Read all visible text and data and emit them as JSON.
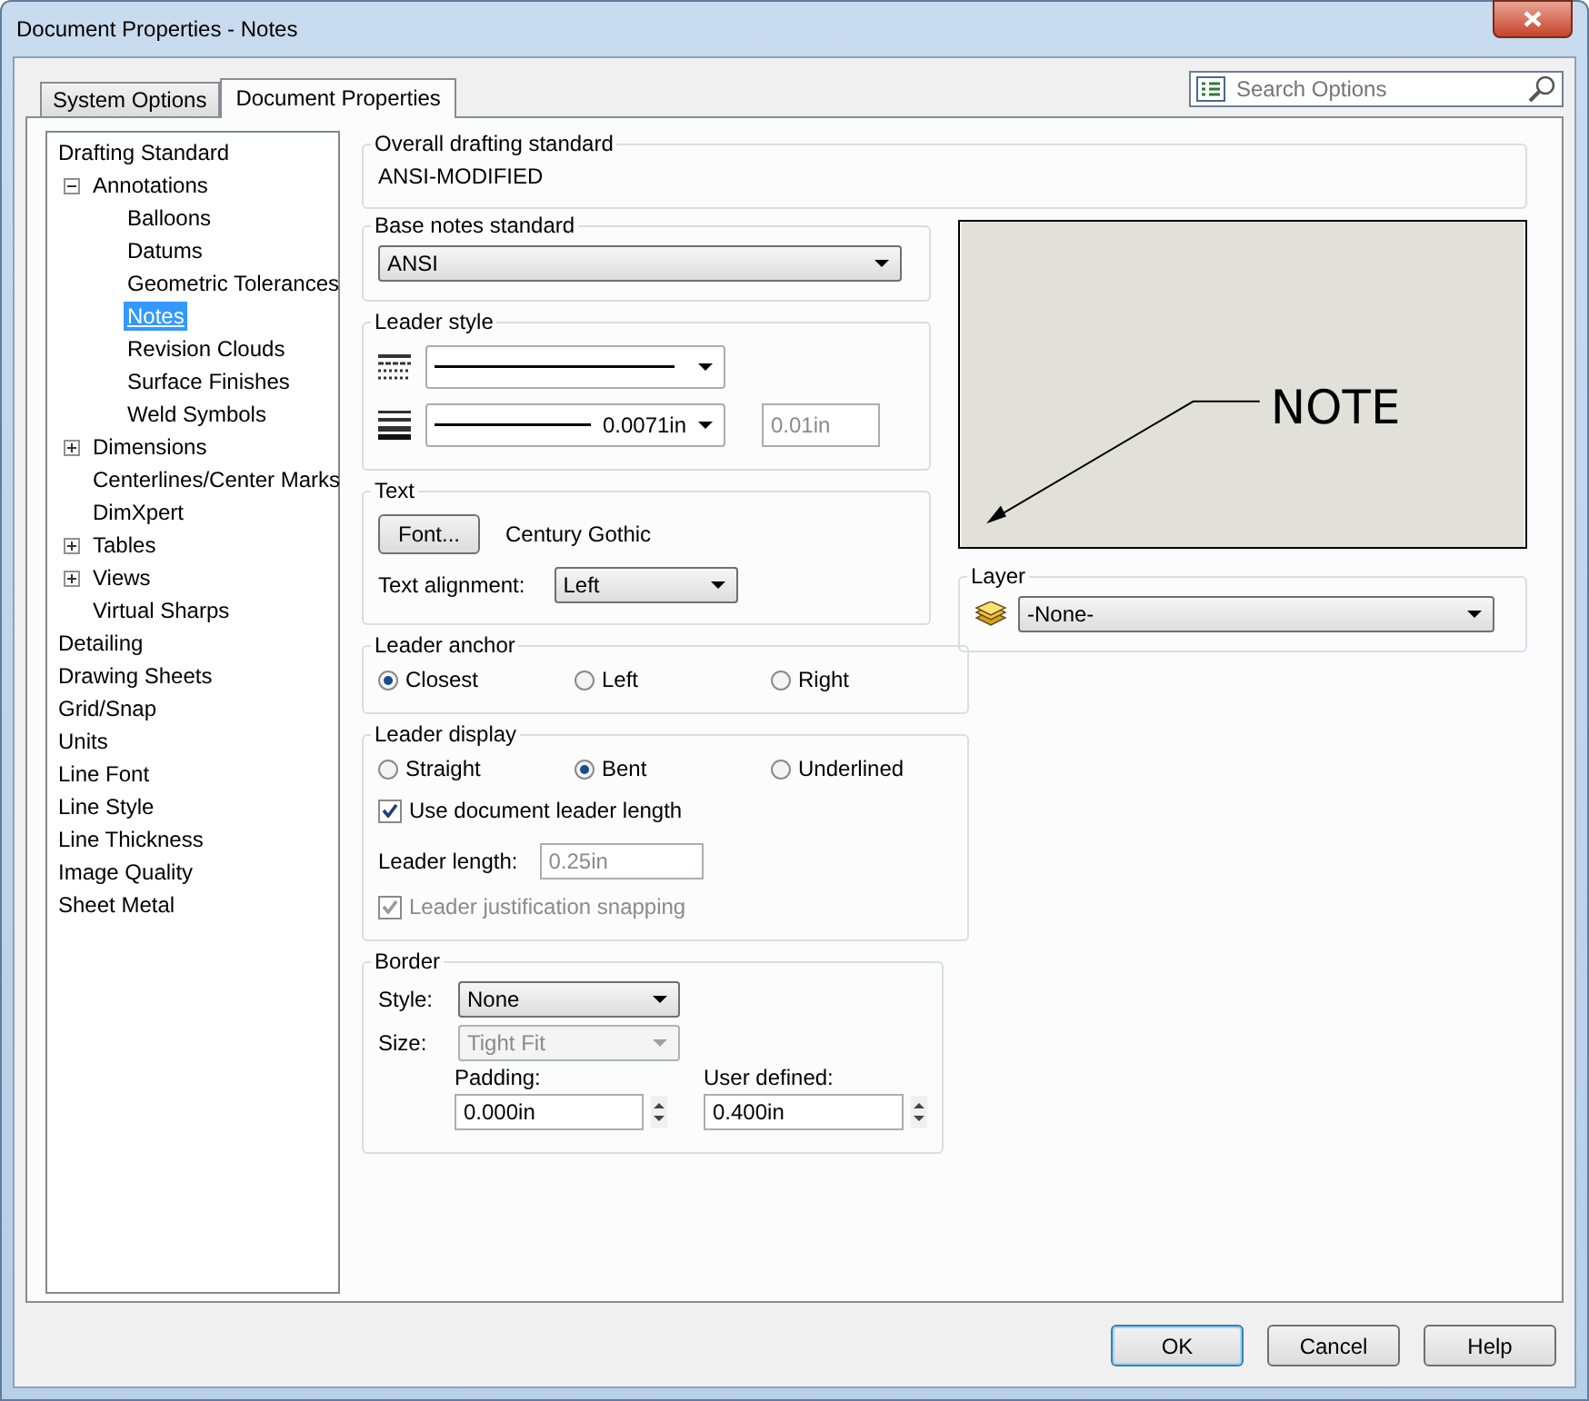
{
  "window": {
    "title": "Document Properties - Notes"
  },
  "tabs": [
    {
      "label": "System Options",
      "selected": false
    },
    {
      "label": "Document Properties",
      "selected": true
    }
  ],
  "search": {
    "placeholder": "Search Options"
  },
  "tree": [
    {
      "label": "Drafting Standard",
      "selected": false,
      "children": [
        {
          "label": "Annotations",
          "selected": false,
          "expanded": true,
          "children": [
            {
              "label": "Balloons",
              "selected": false
            },
            {
              "label": "Datums",
              "selected": false
            },
            {
              "label": "Geometric Tolerances",
              "selected": false
            },
            {
              "label": "Notes",
              "selected": true
            },
            {
              "label": "Revision Clouds",
              "selected": false
            },
            {
              "label": "Surface Finishes",
              "selected": false
            },
            {
              "label": "Weld Symbols",
              "selected": false
            }
          ]
        },
        {
          "label": "Dimensions",
          "selected": false,
          "expanded": false
        },
        {
          "label": "Centerlines/Center Marks",
          "selected": false
        },
        {
          "label": "DimXpert",
          "selected": false
        },
        {
          "label": "Tables",
          "selected": false,
          "expanded": false
        },
        {
          "label": "Views",
          "selected": false,
          "expanded": false
        },
        {
          "label": "Virtual Sharps",
          "selected": false
        }
      ]
    },
    {
      "label": "Detailing",
      "selected": false
    },
    {
      "label": "Drawing Sheets",
      "selected": false
    },
    {
      "label": "Grid/Snap",
      "selected": false
    },
    {
      "label": "Units",
      "selected": false
    },
    {
      "label": "Line Font",
      "selected": false
    },
    {
      "label": "Line Style",
      "selected": false
    },
    {
      "label": "Line Thickness",
      "selected": false
    },
    {
      "label": "Image Quality",
      "selected": false
    },
    {
      "label": "Sheet Metal",
      "selected": false
    }
  ],
  "overall": {
    "title": "Overall drafting standard",
    "value": "ANSI-MODIFIED"
  },
  "base_notes": {
    "title": "Base notes standard",
    "value": "ANSI"
  },
  "leader_style": {
    "title": "Leader style",
    "thickness": "0.0071in",
    "custom_thickness": "0.01in",
    "custom_disabled": true
  },
  "text": {
    "title": "Text",
    "font_button": "Font...",
    "font_name": "Century Gothic",
    "alignment_label": "Text alignment:",
    "alignment": "Left"
  },
  "leader_anchor": {
    "title": "Leader anchor",
    "options": [
      {
        "label": "Closest",
        "selected": true
      },
      {
        "label": "Left",
        "selected": false
      },
      {
        "label": "Right",
        "selected": false
      }
    ]
  },
  "leader_display": {
    "title": "Leader display",
    "options": [
      {
        "label": "Straight",
        "selected": false
      },
      {
        "label": "Bent",
        "selected": true
      },
      {
        "label": "Underlined",
        "selected": false
      }
    ],
    "use_doc_length": {
      "label": "Use document leader length",
      "checked": true,
      "disabled": false
    },
    "length_label": "Leader length:",
    "length": "0.25in",
    "length_disabled": true,
    "snapping": {
      "label": "Leader justification snapping",
      "checked": true,
      "disabled": true
    }
  },
  "border": {
    "title": "Border",
    "style_label": "Style:",
    "style": "None",
    "size_label": "Size:",
    "size": "Tight Fit",
    "size_disabled": true,
    "padding_label": "Padding:",
    "padding": "0.000in",
    "user_label": "User defined:",
    "user": "0.400in"
  },
  "preview": {
    "note": "NOTE"
  },
  "layer": {
    "title": "Layer",
    "value": "-None-"
  },
  "buttons": [
    {
      "label": "OK",
      "default": true
    },
    {
      "label": "Cancel",
      "default": false
    },
    {
      "label": "Help",
      "default": false
    }
  ]
}
